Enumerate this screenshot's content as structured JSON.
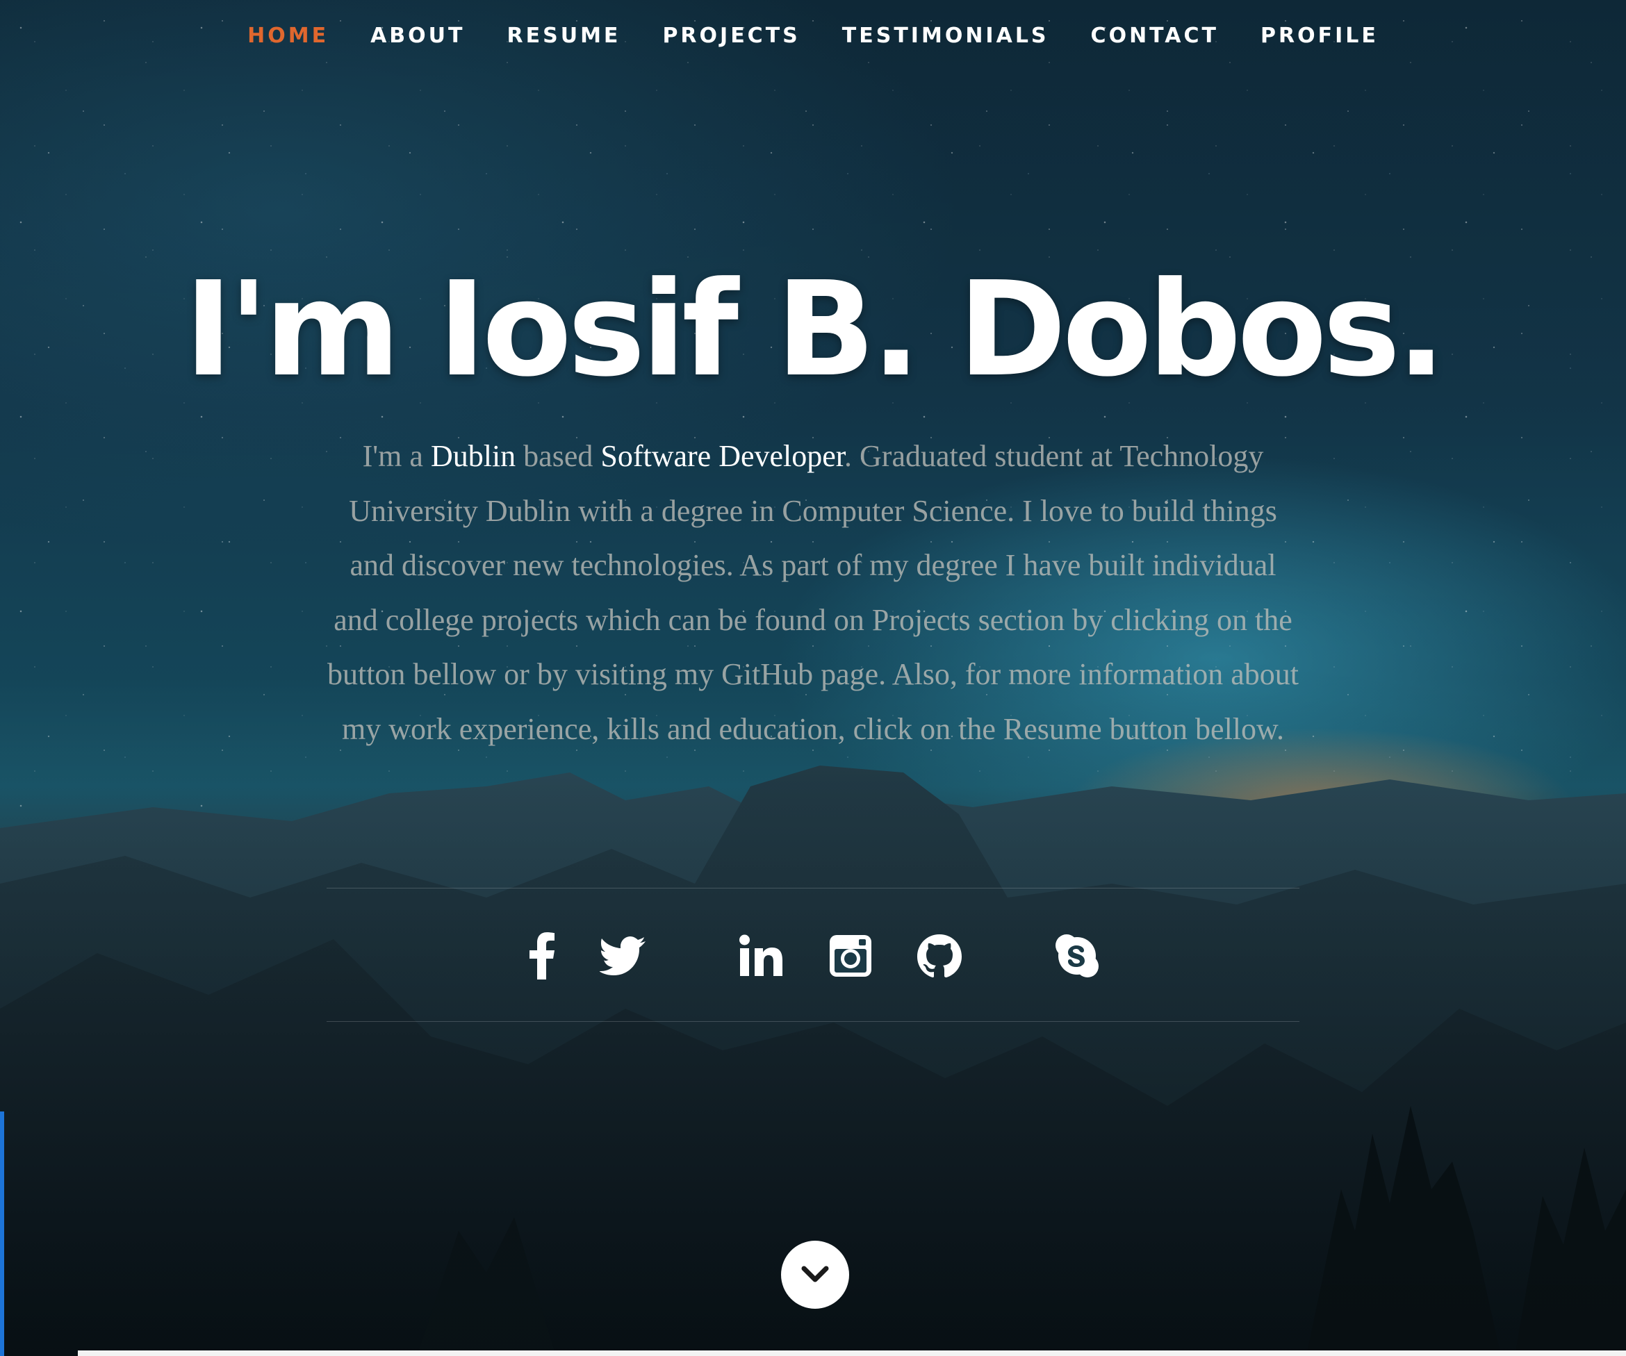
{
  "nav": {
    "items": [
      {
        "label": "HOME",
        "active": true
      },
      {
        "label": "ABOUT",
        "active": false
      },
      {
        "label": "RESUME",
        "active": false
      },
      {
        "label": "PROJECTS",
        "active": false
      },
      {
        "label": "TESTIMONIALS",
        "active": false
      },
      {
        "label": "CONTACT",
        "active": false
      },
      {
        "label": "PROFILE",
        "active": false
      }
    ],
    "active_color": "#e0672e"
  },
  "hero": {
    "title": "I'm Iosif B. Dobos.",
    "intro_1": "I'm a ",
    "city": "Dublin",
    "intro_2": " based ",
    "role": "Software Developer",
    "description": ". Graduated student at Technology University Dublin with a degree in Computer Science. I love to build things and discover new technologies. As part of my degree I have built individual and college projects which can be found on Projects section by clicking on the button bellow or by visiting my GitHub page. Also, for more information about my work experience, kills and education, click on the Resume button bellow."
  },
  "socials": [
    {
      "icon": "facebook-icon"
    },
    {
      "icon": "twitter-icon"
    },
    {
      "icon": "linkedin-icon"
    },
    {
      "icon": "instagram-icon"
    },
    {
      "icon": "github-icon"
    },
    {
      "icon": "skype-icon"
    }
  ],
  "scroll_button": {
    "icon": "chevron-down-icon"
  }
}
